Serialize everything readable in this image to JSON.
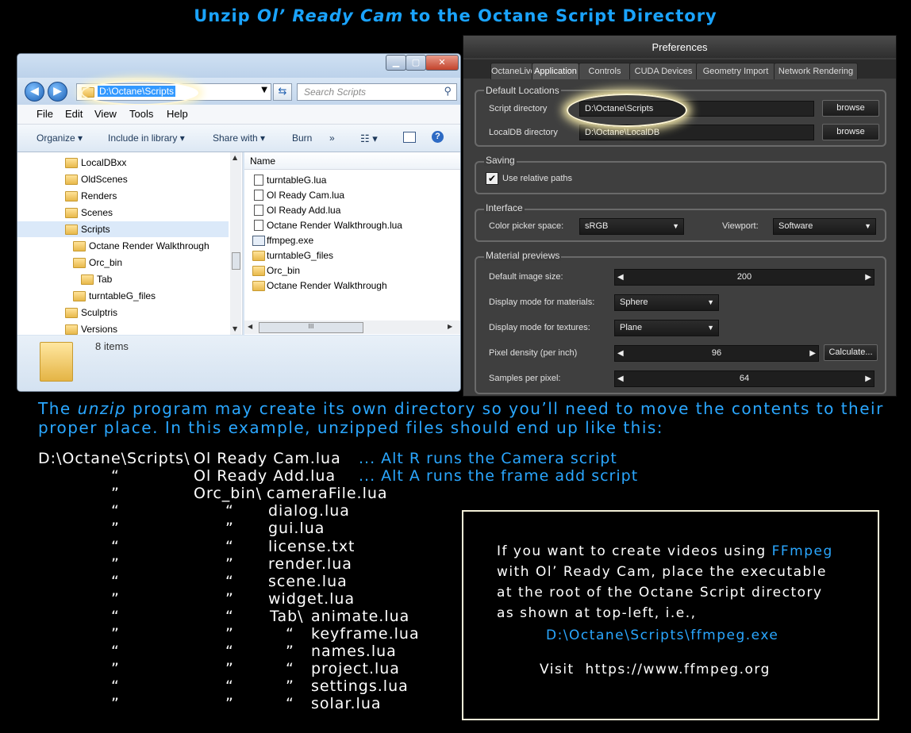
{
  "title": {
    "pre": "Unzip ",
    "italic": "Ol’ Ready Cam",
    "post": " to the Octane Script Directory"
  },
  "explorer": {
    "address": "D:\\Octane\\Scripts",
    "search_placeholder": "Search Scripts",
    "menu": [
      "File",
      "Edit",
      "View",
      "Tools",
      "Help"
    ],
    "toolbar": {
      "organize": "Organize",
      "include": "Include in library",
      "share": "Share with",
      "burn": "Burn",
      "more": "»"
    },
    "nav_items": [
      "LocalDBxx",
      "OldScenes",
      "Renders",
      "Scenes",
      "Scripts",
      "Octane Render Walkthrough",
      "Orc_bin",
      "Tab",
      "turntableG_files",
      "Sculptris",
      "Versions"
    ],
    "column_name": "Name",
    "files": [
      {
        "name": "turntableG.lua",
        "icon": "lua-file-icon"
      },
      {
        "name": "Ol Ready Cam.lua",
        "icon": "lua-file-icon"
      },
      {
        "name": "Ol Ready Add.lua",
        "icon": "lua-file-icon"
      },
      {
        "name": "Octane Render Walkthrough.lua",
        "icon": "lua-file-icon"
      },
      {
        "name": "ffmpeg.exe",
        "icon": "exe-file-icon"
      },
      {
        "name": "turntableG_files",
        "icon": "folder-icon"
      },
      {
        "name": "Orc_bin",
        "icon": "folder-icon"
      },
      {
        "name": "Octane Render Walkthrough",
        "icon": "folder-icon"
      }
    ],
    "status": "8 items",
    "hscroll_label": "III"
  },
  "prefs": {
    "title": "Preferences",
    "tabs": [
      "OctaneLive",
      "Application",
      "Controls",
      "CUDA Devices",
      "Geometry Import",
      "Network Rendering"
    ],
    "default_locations": "Default Locations",
    "script_dir_label": "Script directory",
    "script_dir_value": "D:\\Octane\\Scripts",
    "localdb_label": "LocalDB directory",
    "localdb_value": "D:\\Octane\\LocalDB",
    "browse": "browse",
    "saving": "Saving",
    "relative_paths": "Use relative paths",
    "interface": "Interface",
    "color_picker_label": "Color picker space:",
    "color_picker_value": "sRGB",
    "viewport_label": "Viewport:",
    "viewport_value": "Software",
    "material_previews": "Material previews",
    "default_image_size_label": "Default image size:",
    "default_image_size_value": "200",
    "display_materials_label": "Display mode for materials:",
    "display_materials_value": "Sphere",
    "display_textures_label": "Display mode for textures:",
    "display_textures_value": "Plane",
    "pixel_density_label": "Pixel density (per inch)",
    "pixel_density_value": "96",
    "calculate": "Calculate...",
    "samples_label": "Samples per pixel:",
    "samples_value": "64"
  },
  "body_text": {
    "line1_pre": "The ",
    "line1_italic": "unzip",
    "line1_post": " program may create its own directory so you’ll need to move the contents to their",
    "line2": "proper place. In this example, unzipped files should end up like this:"
  },
  "tree": {
    "root": "D:\\Octane\\Scripts\\",
    "cam": "Ol Ready Cam.lua",
    "cam_note": "... Alt R runs the Camera script",
    "add": "Ol Ready Add.lua",
    "add_note": "... Alt A runs the frame add script",
    "orc": "Orc_bin\\",
    "orc_files": [
      "cameraFile.lua",
      "dialog.lua",
      "gui.lua",
      "license.txt",
      "render.lua",
      "scene.lua",
      "widget.lua"
    ],
    "tab": "Tab\\",
    "tab_files": [
      "animate.lua",
      "keyframe.lua",
      "names.lua",
      "project.lua",
      "settings.lua",
      "solar.lua"
    ],
    "ditto_open": "“",
    "ditto_close": "”"
  },
  "info": {
    "l1_pre": "If you want to create videos using ",
    "l1_link": "FFmpeg",
    "l2": "with Ol’ Ready Cam, place the executable",
    "l3": "at the root of the Octane Script directory",
    "l4": "as shown at top-left, i.e.,",
    "path": "D:\\Octane\\Scripts\\ffmpeg.exe",
    "visit": "Visit  https://www.ffmpeg.org"
  },
  "colors": {
    "accent_blue": "#2aa7ff",
    "box_border": "#f4f0d8"
  }
}
